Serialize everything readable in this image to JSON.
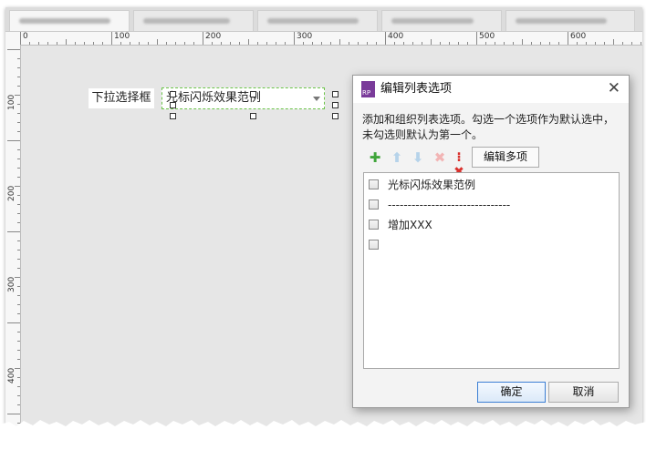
{
  "ruler": {
    "top_labels": [
      "0",
      "100",
      "200",
      "300",
      "400",
      "500",
      "600"
    ],
    "left_labels": [
      "100",
      "200",
      "300",
      "400"
    ]
  },
  "canvas": {
    "label_widget_text": "下拉选择框",
    "dropdown_value": "光标闪烁效果范例"
  },
  "dialog": {
    "title": "编辑列表选项",
    "description": "添加和组织列表选项。勾选一个选项作为默认选中，未勾选则默认为第一个。",
    "toolbar": {
      "add_icon": "plus-icon",
      "up_icon": "arrow-up-icon",
      "down_icon": "arrow-down-icon",
      "delete_icon": "delete-icon",
      "delete_all_icon": "delete-all-icon",
      "edit_multiple_label": "编辑多项"
    },
    "items": [
      {
        "text": "光标闪烁效果范例",
        "checked": false
      },
      {
        "text": "-------------------------------",
        "checked": false
      },
      {
        "text": "增加XXX",
        "checked": false
      },
      {
        "text": "",
        "checked": false
      }
    ],
    "ok_label": "确定",
    "cancel_label": "取消",
    "close_glyph": "✕",
    "app_icon_text": "RP"
  },
  "colors": {
    "accent_blue": "#3c7fd4",
    "selection_green": "#6cc44a",
    "app_purple": "#7a3b9a",
    "add_green": "#3fa53a",
    "delete_red": "#d9302c"
  }
}
